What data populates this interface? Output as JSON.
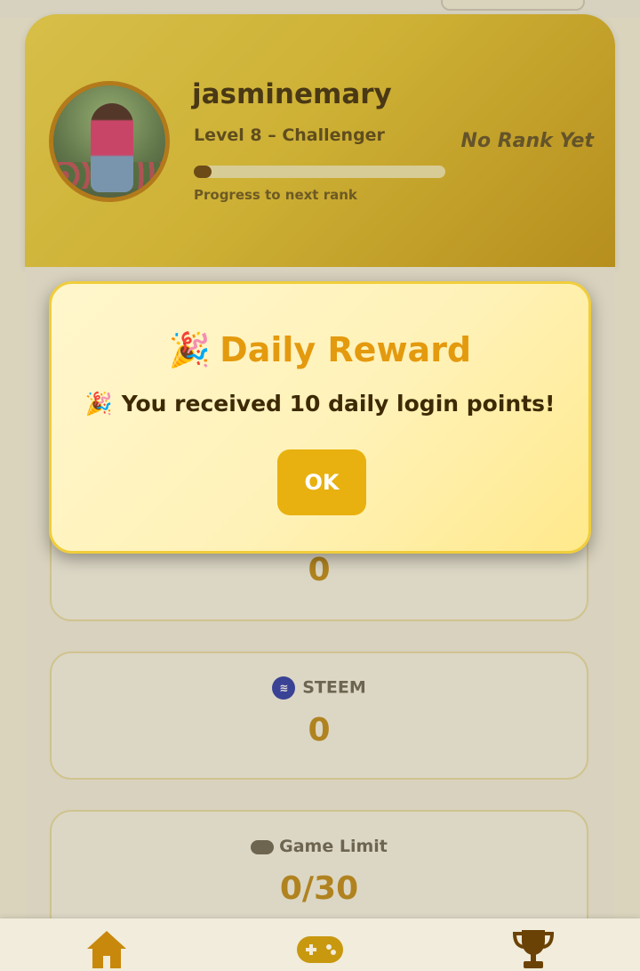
{
  "profile": {
    "username": "jasminemary",
    "level": "Level 8 – Challenger",
    "rank": "No Rank Yet",
    "progress": 0.07,
    "progress_caption": "Progress to next rank"
  },
  "stats": {
    "points_value": "0",
    "steem_label": "STEEM",
    "steem_value": "0",
    "game_limit_label": "Game Limit",
    "game_limit_value": "0/30"
  },
  "modal": {
    "title": "Daily Reward",
    "emoji": "🎉",
    "message": "You received 10 daily login points!",
    "ok_label": "OK"
  },
  "nav": {
    "items": [
      "home-icon",
      "gamepad-icon",
      "trophy-icon"
    ]
  },
  "colors": {
    "accent": "#e8b10f",
    "title": "#e49a0e",
    "dark_text": "#3d2a05"
  }
}
